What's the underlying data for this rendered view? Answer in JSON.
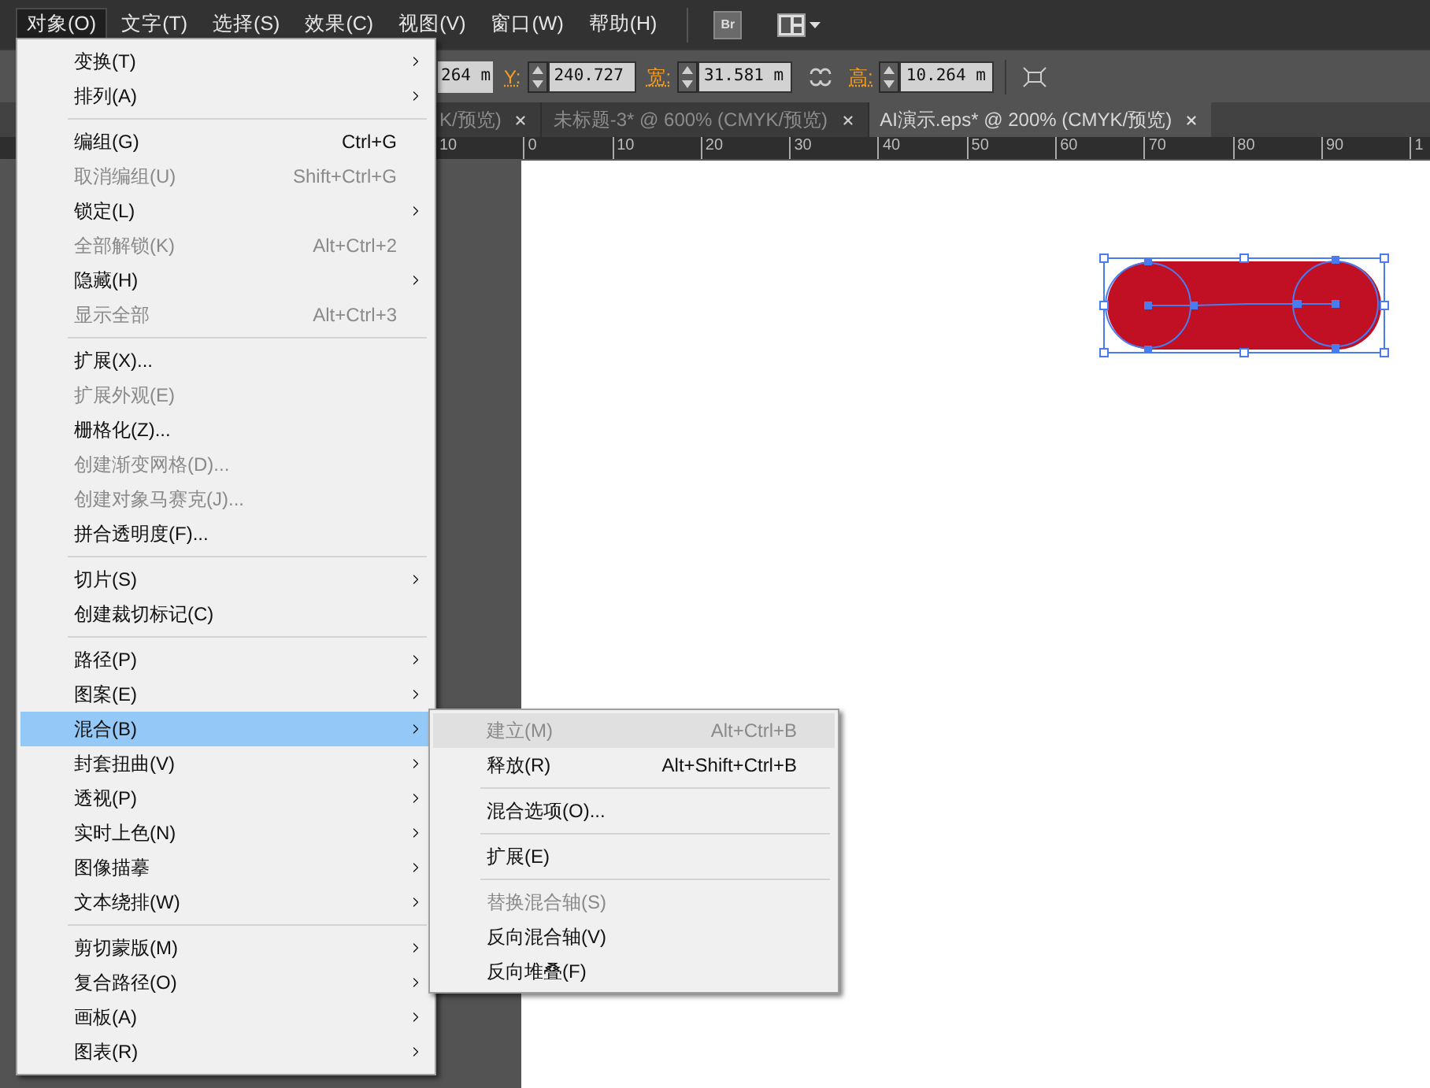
{
  "menu_bar": {
    "items": [
      {
        "label": "对象(O)",
        "selected": true
      },
      {
        "label": "文字(T)",
        "selected": false
      },
      {
        "label": "选择(S)",
        "selected": false
      },
      {
        "label": "效果(C)",
        "selected": false
      },
      {
        "label": "视图(V)",
        "selected": false
      },
      {
        "label": "窗口(W)",
        "selected": false
      },
      {
        "label": "帮助(H)",
        "selected": false
      }
    ],
    "bridge_button": "Br"
  },
  "control_bar": {
    "fields": [
      {
        "value": "264 m"
      },
      {
        "label": "Y:",
        "value": "240.727"
      },
      {
        "label": "宽:",
        "value": "31.581 m"
      },
      {
        "label": "高:",
        "value": "10.264 m"
      }
    ]
  },
  "document_tabs": [
    {
      "title": "K/预览)",
      "selected": false
    },
    {
      "title": "未标题-3* @ 600% (CMYK/预览)",
      "selected": false
    },
    {
      "title": "AI演示.eps* @ 200% (CMYK/预览)",
      "selected": true
    }
  ],
  "ruler": {
    "labels": [
      "10",
      "0",
      "10",
      "20",
      "30",
      "40",
      "50",
      "60",
      "70",
      "80",
      "90",
      "1"
    ]
  },
  "object_menu": {
    "sections": [
      [
        {
          "label": "变换(T)",
          "submenu": true,
          "disabled": false,
          "selected": false
        },
        {
          "label": "排列(A)",
          "submenu": true,
          "disabled": false,
          "selected": false
        }
      ],
      [
        {
          "label": "编组(G)",
          "shortcut": "Ctrl+G",
          "submenu": false,
          "disabled": false,
          "selected": false
        },
        {
          "label": "取消编组(U)",
          "shortcut": "Shift+Ctrl+G",
          "submenu": false,
          "disabled": true,
          "selected": false
        },
        {
          "label": "锁定(L)",
          "submenu": true,
          "disabled": false,
          "selected": false
        },
        {
          "label": "全部解锁(K)",
          "shortcut": "Alt+Ctrl+2",
          "submenu": false,
          "disabled": true,
          "selected": false
        },
        {
          "label": "隐藏(H)",
          "submenu": true,
          "disabled": false,
          "selected": false
        },
        {
          "label": "显示全部",
          "shortcut": "Alt+Ctrl+3",
          "submenu": false,
          "disabled": true,
          "selected": false
        }
      ],
      [
        {
          "label": "扩展(X)...",
          "submenu": false,
          "disabled": false,
          "selected": false
        },
        {
          "label": "扩展外观(E)",
          "submenu": false,
          "disabled": true,
          "selected": false
        },
        {
          "label": "栅格化(Z)...",
          "submenu": false,
          "disabled": false,
          "selected": false
        },
        {
          "label": "创建渐变网格(D)...",
          "submenu": false,
          "disabled": true,
          "selected": false
        },
        {
          "label": "创建对象马赛克(J)...",
          "submenu": false,
          "disabled": true,
          "selected": false
        },
        {
          "label": "拼合透明度(F)...",
          "submenu": false,
          "disabled": false,
          "selected": false
        }
      ],
      [
        {
          "label": "切片(S)",
          "submenu": true,
          "disabled": false,
          "selected": false
        },
        {
          "label": "创建裁切标记(C)",
          "submenu": false,
          "disabled": false,
          "selected": false
        }
      ],
      [
        {
          "label": "路径(P)",
          "submenu": true,
          "disabled": false,
          "selected": false
        },
        {
          "label": "图案(E)",
          "submenu": true,
          "disabled": false,
          "selected": false
        },
        {
          "label": "混合(B)",
          "submenu": true,
          "disabled": false,
          "selected": true
        },
        {
          "label": "封套扭曲(V)",
          "submenu": true,
          "disabled": false,
          "selected": false
        },
        {
          "label": "透视(P)",
          "submenu": true,
          "disabled": false,
          "selected": false
        },
        {
          "label": "实时上色(N)",
          "submenu": true,
          "disabled": false,
          "selected": false
        },
        {
          "label": "图像描摹",
          "submenu": true,
          "disabled": false,
          "selected": false
        },
        {
          "label": "文本绕排(W)",
          "submenu": true,
          "disabled": false,
          "selected": false
        }
      ],
      [
        {
          "label": "剪切蒙版(M)",
          "submenu": true,
          "disabled": false,
          "selected": false
        },
        {
          "label": "复合路径(O)",
          "submenu": true,
          "disabled": false,
          "selected": false
        },
        {
          "label": "画板(A)",
          "submenu": true,
          "disabled": false,
          "selected": false
        },
        {
          "label": "图表(R)",
          "submenu": true,
          "disabled": false,
          "selected": false
        }
      ]
    ]
  },
  "blend_submenu": {
    "sections": [
      [
        {
          "label": "建立(M)",
          "shortcut": "Alt+Ctrl+B",
          "disabled": true,
          "selected": true
        },
        {
          "label": "释放(R)",
          "shortcut": "Alt+Shift+Ctrl+B",
          "disabled": false,
          "selected": false
        }
      ],
      [
        {
          "label": "混合选项(O)...",
          "disabled": false,
          "selected": false
        }
      ],
      [
        {
          "label": "扩展(E)",
          "disabled": false,
          "selected": false
        }
      ],
      [
        {
          "label": "替换混合轴(S)",
          "disabled": true,
          "selected": false
        },
        {
          "label": "反向混合轴(V)",
          "disabled": false,
          "selected": false
        },
        {
          "label": "反向堆叠(F)",
          "disabled": false,
          "selected": false
        }
      ]
    ]
  }
}
